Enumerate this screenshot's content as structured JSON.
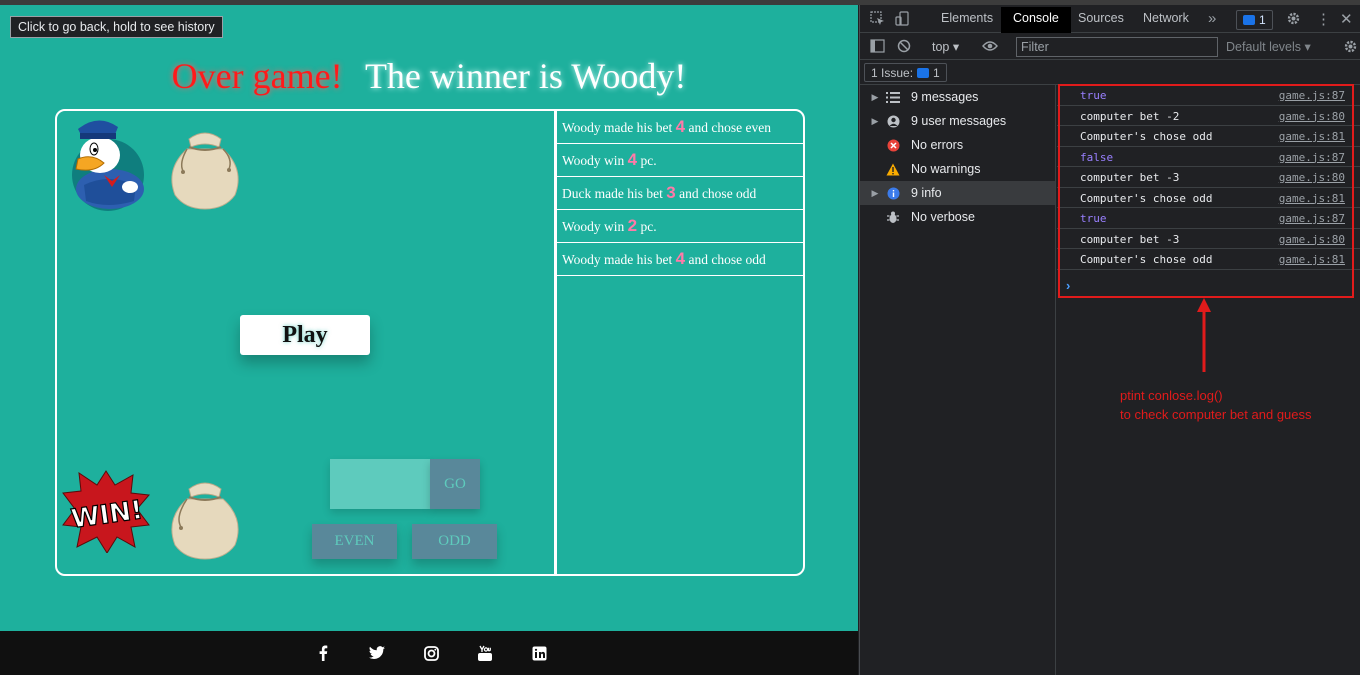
{
  "tooltip": "Click to go back, hold to see history",
  "headline": {
    "over": "Over game!",
    "winner": "The winner is Woody!"
  },
  "game": {
    "play_label": "Play",
    "go_label": "GO",
    "even_label": "EVEN",
    "odd_label": "ODD",
    "input_value": ""
  },
  "log": [
    {
      "pre": "Woody made his bet ",
      "num": "4",
      "post": " and chose even"
    },
    {
      "pre": "Woody win ",
      "num": "4",
      "post": " pc."
    },
    {
      "pre": "Duck made his bet ",
      "num": "3",
      "post": " and chose odd"
    },
    {
      "pre": "Woody win ",
      "num": "2",
      "post": " pc."
    },
    {
      "pre": "Woody made his bet ",
      "num": "4",
      "post": " and chose odd"
    }
  ],
  "footer": {
    "icons": [
      "facebook-icon",
      "twitter-icon",
      "instagram-icon",
      "youtube-icon",
      "linkedin-icon"
    ]
  },
  "devtools": {
    "tabs": [
      "Elements",
      "Console",
      "Sources",
      "Network"
    ],
    "active_tab": "Console",
    "issue_count": "1",
    "context": "top",
    "filter_placeholder": "Filter",
    "levels": "Default levels",
    "issues_label": "1 Issue:",
    "issues_count": "1",
    "sidebar": [
      {
        "label": "9 messages",
        "icon": "list-icon",
        "expandable": true
      },
      {
        "label": "9 user messages",
        "icon": "user-icon",
        "expandable": true
      },
      {
        "label": "No errors",
        "icon": "error-icon",
        "expandable": false
      },
      {
        "label": "No warnings",
        "icon": "warning-icon",
        "expandable": false
      },
      {
        "label": "9 info",
        "icon": "info-icon",
        "expandable": true,
        "active": true
      },
      {
        "label": "No verbose",
        "icon": "bug-icon",
        "expandable": false
      }
    ],
    "console_rows": [
      {
        "text": "true",
        "type": "bool",
        "src": "game.js:87"
      },
      {
        "text": "computer bet -2",
        "type": "text",
        "src": "game.js:80"
      },
      {
        "text": "Computer's chose odd",
        "type": "text",
        "src": "game.js:81"
      },
      {
        "text": "false",
        "type": "bool",
        "src": "game.js:87"
      },
      {
        "text": "computer bet -3",
        "type": "text",
        "src": "game.js:80"
      },
      {
        "text": "Computer's chose odd",
        "type": "text",
        "src": "game.js:81"
      },
      {
        "text": "true",
        "type": "bool",
        "src": "game.js:87"
      },
      {
        "text": "computer bet -3",
        "type": "text",
        "src": "game.js:80"
      },
      {
        "text": "Computer's chose odd",
        "type": "text",
        "src": "game.js:81"
      }
    ]
  },
  "annotation": {
    "line1": "ptint conlose.log()",
    "line2": "to check computer bet and guess"
  },
  "colors": {
    "page_bg": "#1eb09d",
    "accent_red": "#e11b1b",
    "bet_number": "#ff7aa8"
  }
}
